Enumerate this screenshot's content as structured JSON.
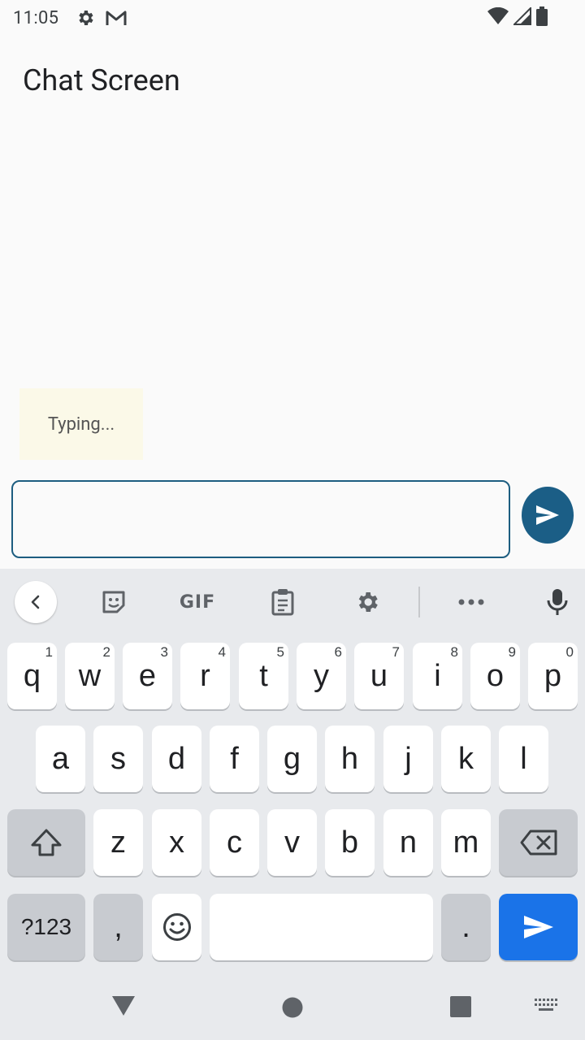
{
  "status_bar": {
    "time": "11:05",
    "icons": [
      "settings-icon",
      "gmail-icon",
      "wifi-icon",
      "signal-icon",
      "battery-icon"
    ]
  },
  "header": {
    "title": "Chat Screen"
  },
  "chat": {
    "typing_indicator": "Typing..."
  },
  "composer": {
    "input_value": "",
    "placeholder": ""
  },
  "keyboard": {
    "toolbar": {
      "gif_label": "GIF",
      "items": [
        "back-icon",
        "sticker-icon",
        "gif-button",
        "clipboard-icon",
        "settings-icon",
        "more-icon",
        "mic-icon"
      ]
    },
    "row1": [
      {
        "key": "q",
        "hint": "1"
      },
      {
        "key": "w",
        "hint": "2"
      },
      {
        "key": "e",
        "hint": "3"
      },
      {
        "key": "r",
        "hint": "4"
      },
      {
        "key": "t",
        "hint": "5"
      },
      {
        "key": "y",
        "hint": "6"
      },
      {
        "key": "u",
        "hint": "7"
      },
      {
        "key": "i",
        "hint": "8"
      },
      {
        "key": "o",
        "hint": "9"
      },
      {
        "key": "p",
        "hint": "0"
      }
    ],
    "row2": [
      "a",
      "s",
      "d",
      "f",
      "g",
      "h",
      "j",
      "k",
      "l"
    ],
    "row3": [
      "z",
      "x",
      "c",
      "v",
      "b",
      "n",
      "m"
    ],
    "row4": {
      "symbols_label": "?123",
      "comma_label": ",",
      "period_label": "."
    }
  },
  "colors": {
    "accent": "#1b5e86",
    "enter_key": "#1a73e8",
    "typing_bubble": "#fbf9e8"
  }
}
